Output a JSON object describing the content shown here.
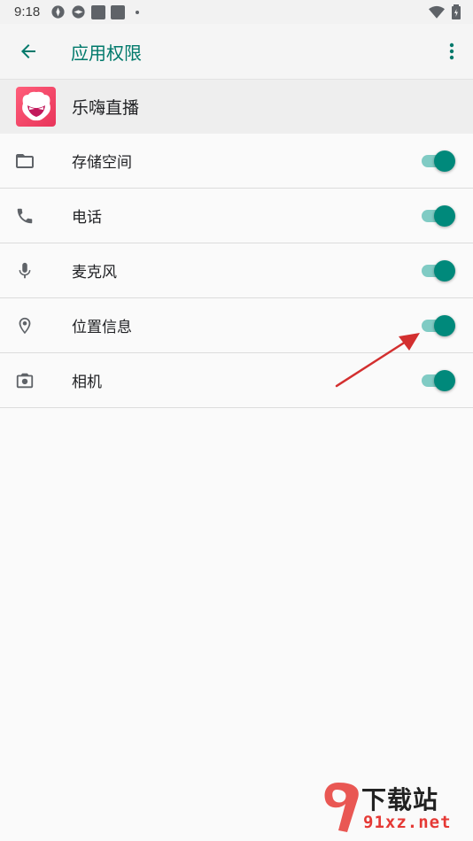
{
  "status_bar": {
    "time": "9:18"
  },
  "app_bar": {
    "title": "应用权限"
  },
  "app_header": {
    "app_name": "乐嗨直播"
  },
  "permissions": [
    {
      "label": "存储空间",
      "icon": "folder-icon",
      "enabled": true
    },
    {
      "label": "电话",
      "icon": "phone-icon",
      "enabled": true
    },
    {
      "label": "麦克风",
      "icon": "microphone-icon",
      "enabled": true
    },
    {
      "label": "位置信息",
      "icon": "location-icon",
      "enabled": true
    },
    {
      "label": "相机",
      "icon": "camera-icon",
      "enabled": true
    }
  ],
  "colors": {
    "accent": "#00796b",
    "toggle_thumb": "#00897b",
    "toggle_track": "#80cbc4",
    "annotation_arrow": "#d32f2f"
  },
  "watermark": {
    "brand": "下载站",
    "site": "91xz.net"
  }
}
